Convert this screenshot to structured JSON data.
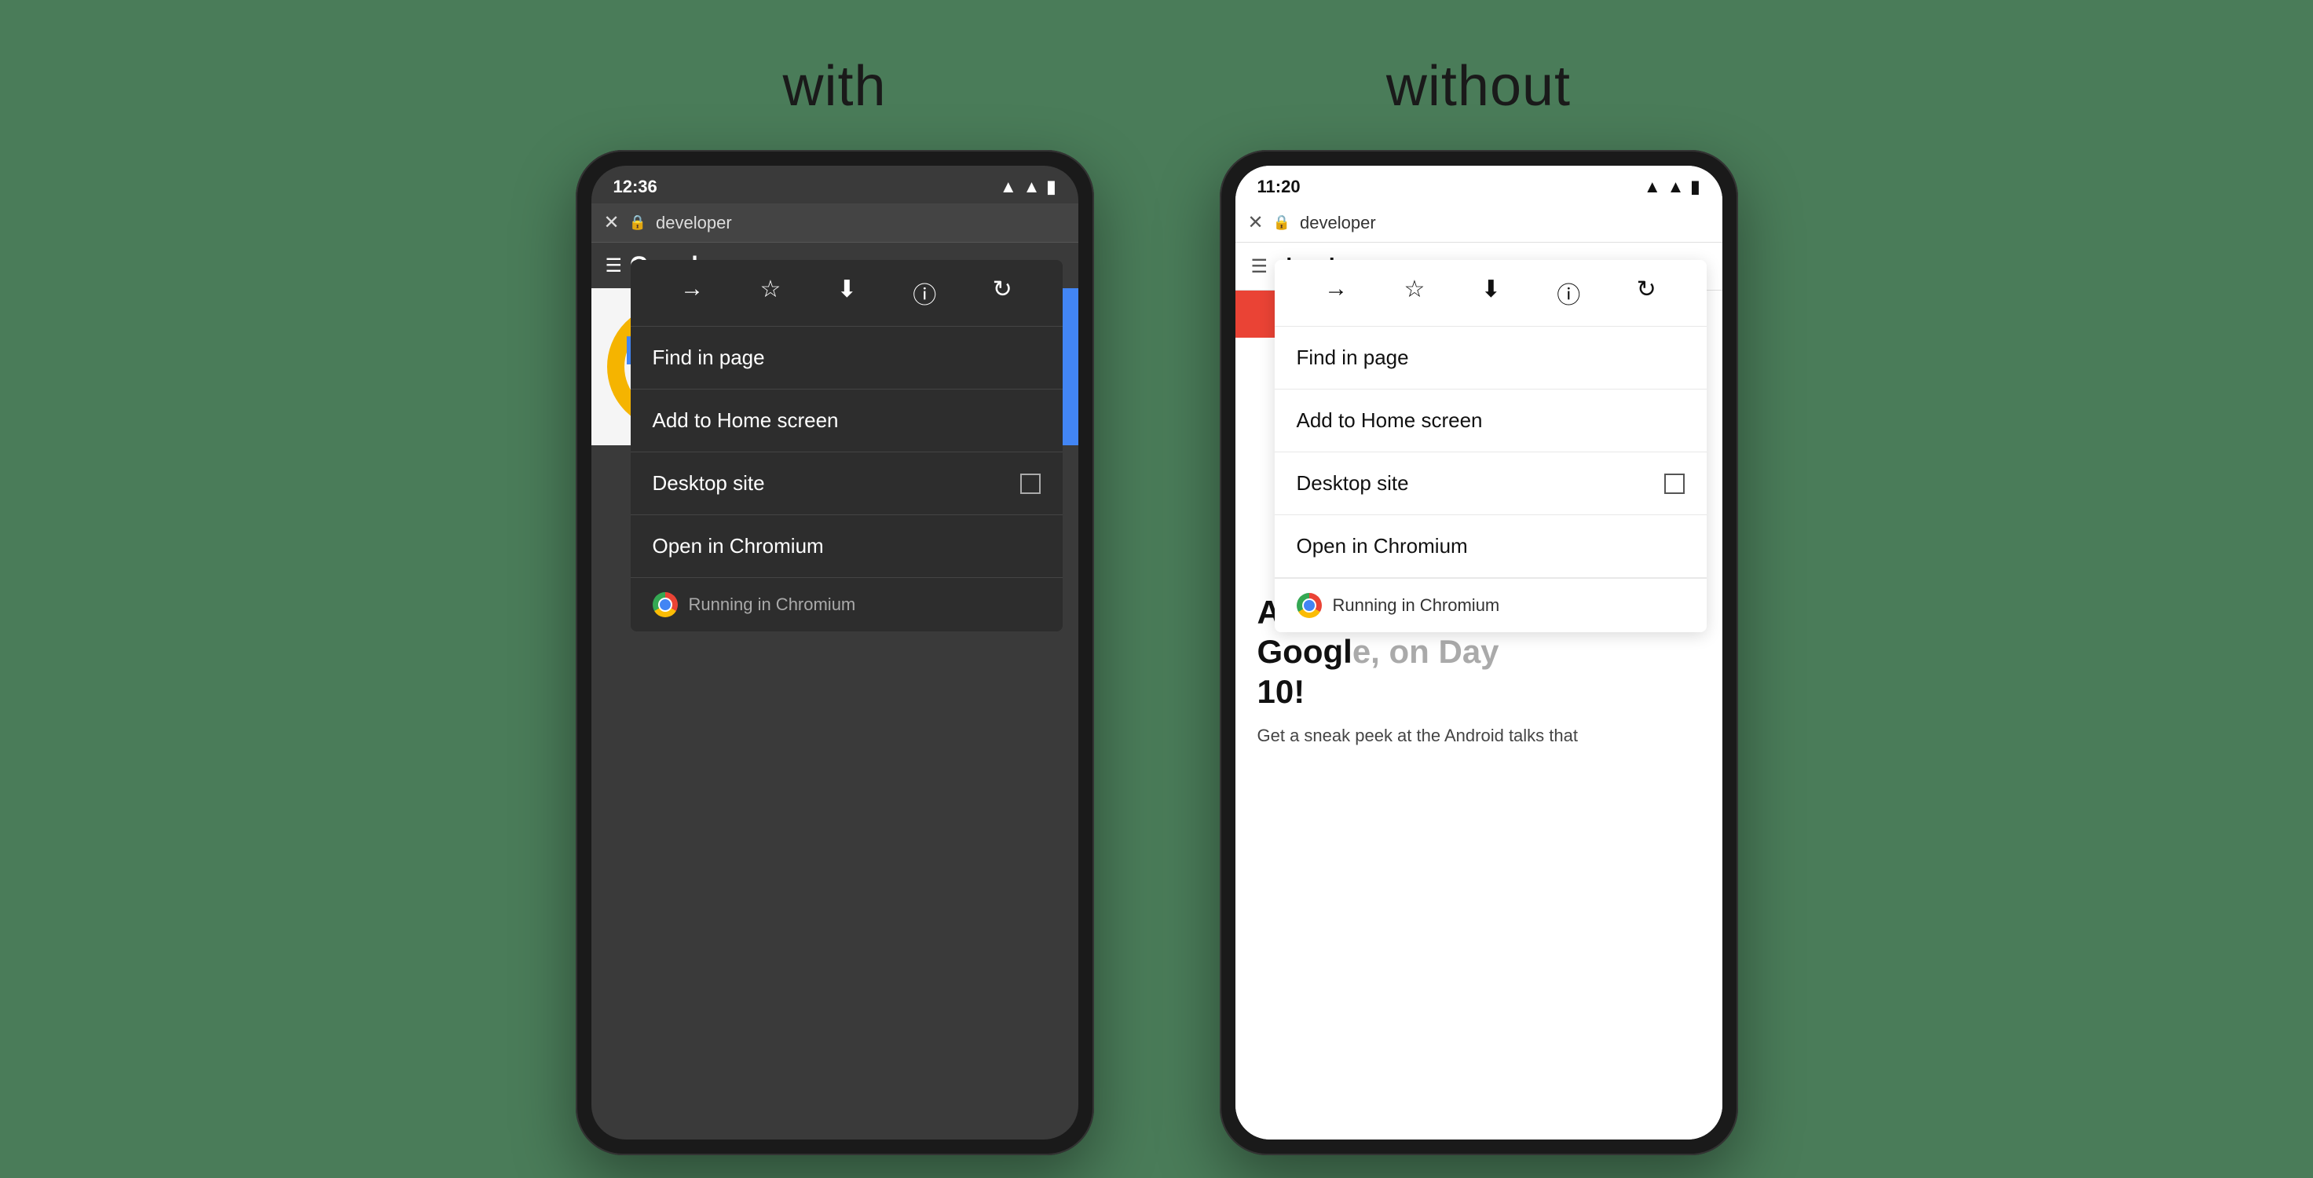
{
  "layout": {
    "background_color": "#4a7c59"
  },
  "left_section": {
    "label": "with",
    "phone": {
      "time": "12:36",
      "url": "developer",
      "menu": {
        "icons": [
          "→",
          "☆",
          "⬇",
          "ⓘ",
          "↻"
        ],
        "items": [
          {
            "label": "Find in page",
            "has_checkbox": false
          },
          {
            "label": "Add to Home screen",
            "has_checkbox": false
          },
          {
            "label": "Desktop site",
            "has_checkbox": true
          },
          {
            "label": "Open in Chromium",
            "has_checkbox": false
          }
        ],
        "footer": "Running in Chromium",
        "theme": "dark"
      }
    }
  },
  "right_section": {
    "label": "without",
    "phone": {
      "time": "11:20",
      "url": "developer",
      "menu": {
        "icons": [
          "→",
          "☆",
          "⬇",
          "ⓘ",
          "↻"
        ],
        "items": [
          {
            "label": "Find in page",
            "has_checkbox": false
          },
          {
            "label": "Add to Home screen",
            "has_checkbox": false
          },
          {
            "label": "Desktop site",
            "has_checkbox": true
          },
          {
            "label": "Open in Chromium",
            "has_checkbox": false
          }
        ],
        "footer": "Running in Chromium",
        "theme": "light"
      }
    }
  }
}
